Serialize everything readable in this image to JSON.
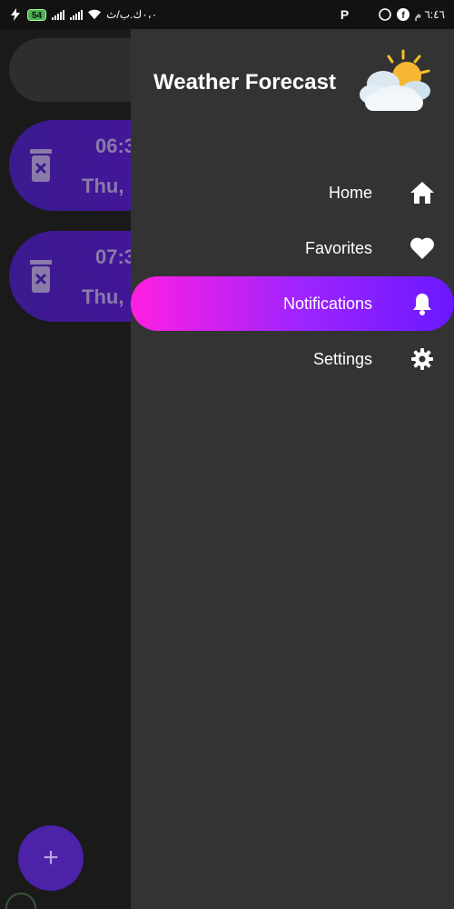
{
  "status_bar": {
    "battery": "54",
    "left_text": "٠،٠ك.ب/ث",
    "right_text": "٦:٤٦ م"
  },
  "background": {
    "alerts": [
      {
        "time": "06:3",
        "date": "Thu,"
      },
      {
        "time": "07:3",
        "date": "Thu,"
      }
    ],
    "fab_label": "+"
  },
  "drawer": {
    "title": "Weather Forecast",
    "items": [
      {
        "label": "Home",
        "icon": "home-icon"
      },
      {
        "label": "Favorites",
        "icon": "heart-icon"
      },
      {
        "label": "Notifications",
        "icon": "bell-icon",
        "active": true
      },
      {
        "label": "Settings",
        "icon": "gear-icon"
      }
    ]
  },
  "colors": {
    "drawer_bg": "#333333",
    "active_gradient_start": "#ff1fe0",
    "active_gradient_end": "#6a18ff",
    "card_purple": "#4a12a3"
  }
}
